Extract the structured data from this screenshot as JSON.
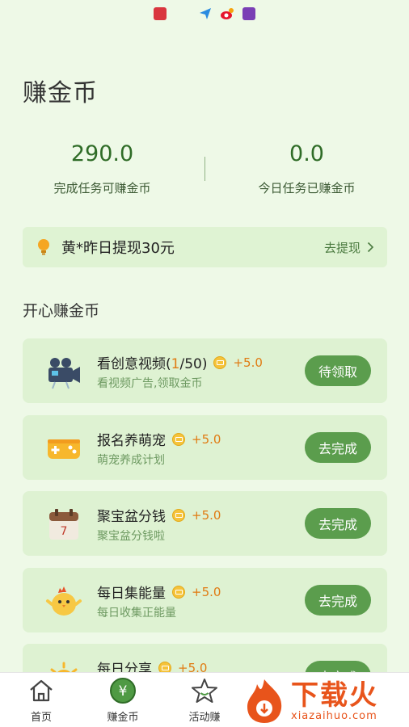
{
  "status_bar": {
    "icons": [
      "book-icon",
      "send-icon",
      "weibo-icon",
      "app-icon"
    ]
  },
  "header": {
    "title": "赚金币"
  },
  "stats": {
    "earnable_value": "290.0",
    "earnable_label": "完成任务可赚金币",
    "earned_today_value": "0.0",
    "earned_today_label": "今日任务已赚金币"
  },
  "notice": {
    "text": "黄*昨日提现30元",
    "link_label": "去提现"
  },
  "section": {
    "title": "开心赚金币"
  },
  "tasks": [
    {
      "title": "看创意视频",
      "progress_prefix": "(",
      "progress_done": "1",
      "progress_rest": "/50)",
      "reward": "+5.0",
      "desc": "看视频广告,领取金币",
      "button": "待领取",
      "icon": "video-camera-icon"
    },
    {
      "title": "报名养萌宠",
      "reward": "+5.0",
      "desc": "萌宠养成计划",
      "button": "去完成",
      "icon": "gamepad-icon"
    },
    {
      "title": "聚宝盆分钱",
      "reward": "+5.0",
      "desc": "聚宝盆分钱啦",
      "button": "去完成",
      "icon": "calendar-icon",
      "calendar_day": "7"
    },
    {
      "title": "每日集能量",
      "reward": "+5.0",
      "desc": "每日收集正能量",
      "button": "去完成",
      "icon": "chick-icon"
    },
    {
      "title": "每日分享",
      "reward": "+5.0",
      "desc": "",
      "button": "去完成",
      "icon": "sun-icon"
    }
  ],
  "tab_bar": {
    "tabs": [
      {
        "label": "首页",
        "icon": "home-icon"
      },
      {
        "label": "赚金币",
        "icon": "yuan-coin-icon"
      },
      {
        "label": "活动赚",
        "icon": "star-icon"
      }
    ]
  },
  "watermark": {
    "main": "下载火",
    "sub": "xiazaihuo.com"
  },
  "colors": {
    "accent": "#5b9d4d",
    "background": "#eef9e7",
    "card": "#def2d2",
    "reward": "#e07b13"
  }
}
